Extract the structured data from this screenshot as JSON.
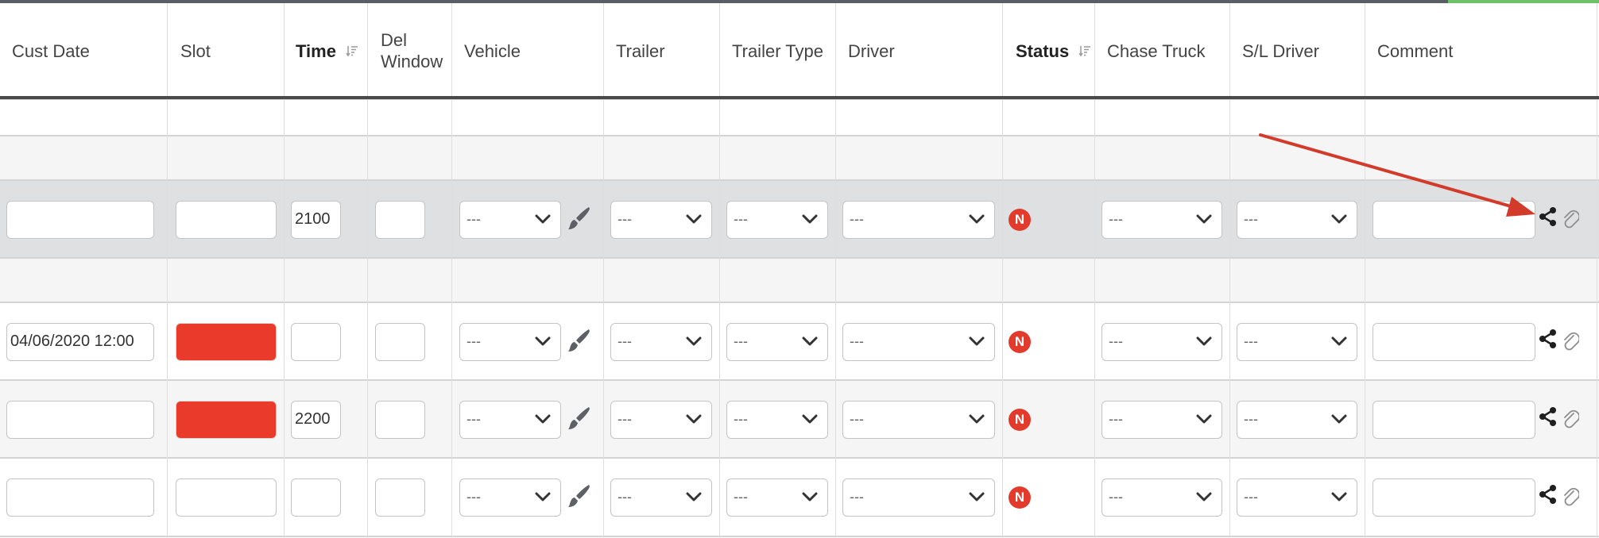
{
  "columns": [
    {
      "label": "Cust Date",
      "bold": false
    },
    {
      "label": "Slot",
      "bold": false
    },
    {
      "label": "Time",
      "bold": true,
      "sortable": true
    },
    {
      "label": "Del Window",
      "bold": false
    },
    {
      "label": "Vehicle",
      "bold": false
    },
    {
      "label": "Trailer",
      "bold": false
    },
    {
      "label": "Trailer Type",
      "bold": false
    },
    {
      "label": "Driver",
      "bold": false
    },
    {
      "label": "Status",
      "bold": true,
      "sortable": true
    },
    {
      "label": "Chase Truck",
      "bold": false
    },
    {
      "label": "S/L Driver",
      "bold": false
    },
    {
      "label": "Comment",
      "bold": false
    }
  ],
  "select_placeholder": "---",
  "rows": [
    {
      "cust_date": "",
      "slot_color": "",
      "time": "2100",
      "del_window": "",
      "vehicle": "---",
      "trailer": "---",
      "trailer_type": "---",
      "driver": "---",
      "status": "N",
      "chase_truck": "---",
      "sl_driver": "---",
      "comment": ""
    },
    {
      "cust_date": "04/06/2020 12:00",
      "slot_color": "#e93a2b",
      "time": "",
      "del_window": "",
      "vehicle": "---",
      "trailer": "---",
      "trailer_type": "---",
      "driver": "---",
      "status": "N",
      "chase_truck": "---",
      "sl_driver": "---",
      "comment": ""
    },
    {
      "cust_date": "",
      "slot_color": "#e93a2b",
      "time": "2200",
      "del_window": "",
      "vehicle": "---",
      "trailer": "---",
      "trailer_type": "---",
      "driver": "---",
      "status": "N",
      "chase_truck": "---",
      "sl_driver": "---",
      "comment": ""
    },
    {
      "cust_date": "",
      "slot_color": "",
      "time": "",
      "del_window": "",
      "vehicle": "---",
      "trailer": "---",
      "trailer_type": "---",
      "driver": "---",
      "status": "N",
      "chase_truck": "---",
      "sl_driver": "---",
      "comment": ""
    }
  ],
  "icons": {
    "sort": "sort-descending-icon",
    "brush": "paintbrush-icon",
    "chevron": "chevron-down-icon",
    "share": "share-icon",
    "attach": "paperclip-icon",
    "annotation": "red-arrow-annotation"
  },
  "colors": {
    "status_badge": "#e23b2c",
    "slot_red": "#e93a2b",
    "highlight_row": "#dfe0e2",
    "annotation_arrow": "#d23a2a",
    "top_bar": "#5a5e66",
    "top_bar_accent": "#6cc16a"
  }
}
